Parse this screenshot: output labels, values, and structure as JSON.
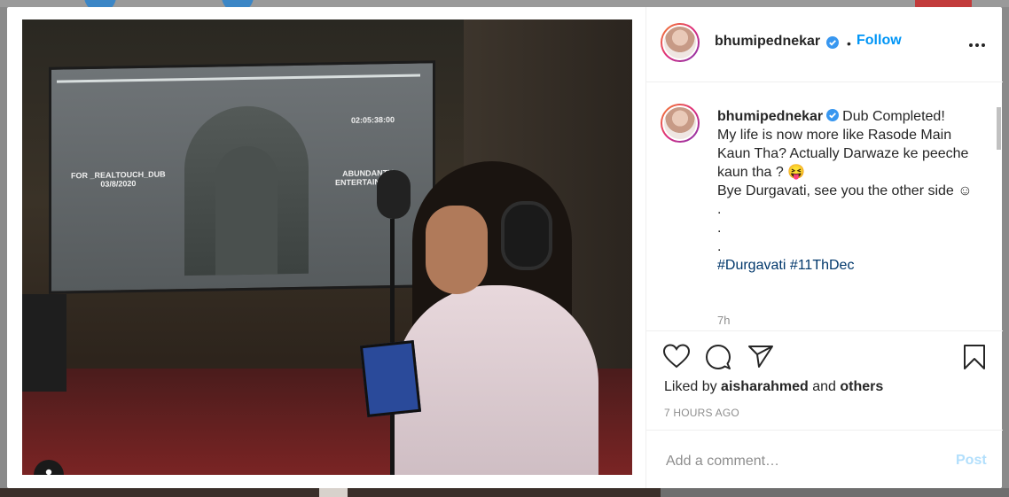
{
  "post": {
    "username": "bhumipednekar",
    "follow_label": "Follow",
    "dot": "•",
    "more_icon": "more-options-icon",
    "caption": "Dub Completed!\nMy life is now more like Rasode Main Kaun Tha? Actually Darwaze ke peeche kaun tha ? 😝\nBye Durgavati, see you the other side ☺\n.\n.\n.",
    "hashtags": "#Durgavati #11ThDec",
    "caption_time": "7h",
    "liked_prefix": "Liked by ",
    "liked_user": "aisharahmed",
    "liked_and": " and ",
    "liked_others": "others",
    "time_ago": "7 HOURS AGO",
    "comment_placeholder": "Add a comment…",
    "post_label": "Post"
  },
  "image": {
    "screen_left_text": "FOR _REALTOUCH_DUB\n03/8/2020",
    "screen_right_text": "ABUNDANTIA\nENTERTAINMENT",
    "screen_timecode": "02:05:38:00"
  },
  "colors": {
    "accent": "#0095f6",
    "text": "#262626",
    "muted": "#8e8e8e",
    "post_disabled": "#b2dffc"
  }
}
